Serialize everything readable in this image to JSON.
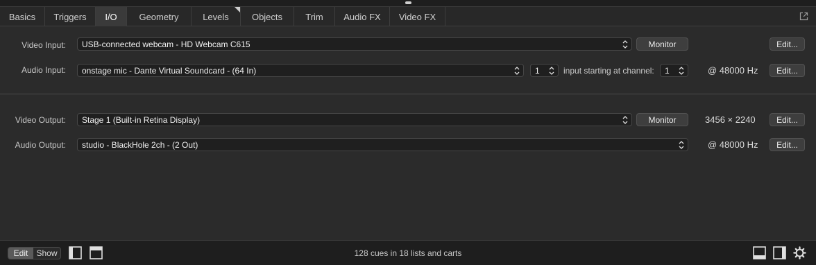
{
  "tabs": [
    {
      "label": "Basics",
      "active": false
    },
    {
      "label": "Triggers",
      "active": false
    },
    {
      "label": "I/O",
      "active": true
    },
    {
      "label": "Geometry",
      "active": false
    },
    {
      "label": "Levels",
      "active": false,
      "marker": true
    },
    {
      "label": "Objects",
      "active": false
    },
    {
      "label": "Trim",
      "active": false
    },
    {
      "label": "Audio FX",
      "active": false
    },
    {
      "label": "Video FX",
      "active": false
    }
  ],
  "inputs": {
    "video": {
      "label": "Video Input:",
      "device": "USB-connected webcam - HD Webcam C615",
      "monitor_label": "Monitor",
      "edit_label": "Edit..."
    },
    "audio": {
      "label": "Audio Input:",
      "device": "onstage mic - Dante Virtual Soundcard - (64 In)",
      "channel_count": "1",
      "start_label": "input starting at channel:",
      "start_channel": "1",
      "rate": "@ 48000 Hz",
      "edit_label": "Edit..."
    }
  },
  "outputs": {
    "video": {
      "label": "Video Output:",
      "device": "Stage 1 (Built-in Retina Display)",
      "monitor_label": "Monitor",
      "resolution": "3456 × 2240",
      "edit_label": "Edit..."
    },
    "audio": {
      "label": "Audio Output:",
      "device": "studio - BlackHole 2ch - (2 Out)",
      "rate": "@ 48000 Hz",
      "edit_label": "Edit..."
    }
  },
  "footer": {
    "mode_edit": "Edit",
    "mode_show": "Show",
    "status": "128 cues in 18 lists and carts",
    "icons": [
      "sidebar-left-icon",
      "inspector-top-icon",
      "panel-bottom-icon",
      "panel-right-icon",
      "gear-icon"
    ]
  },
  "colors": {
    "background": "#1e1e1e",
    "panel": "#2b2b2b",
    "active_tab": "#3a3a3a"
  }
}
